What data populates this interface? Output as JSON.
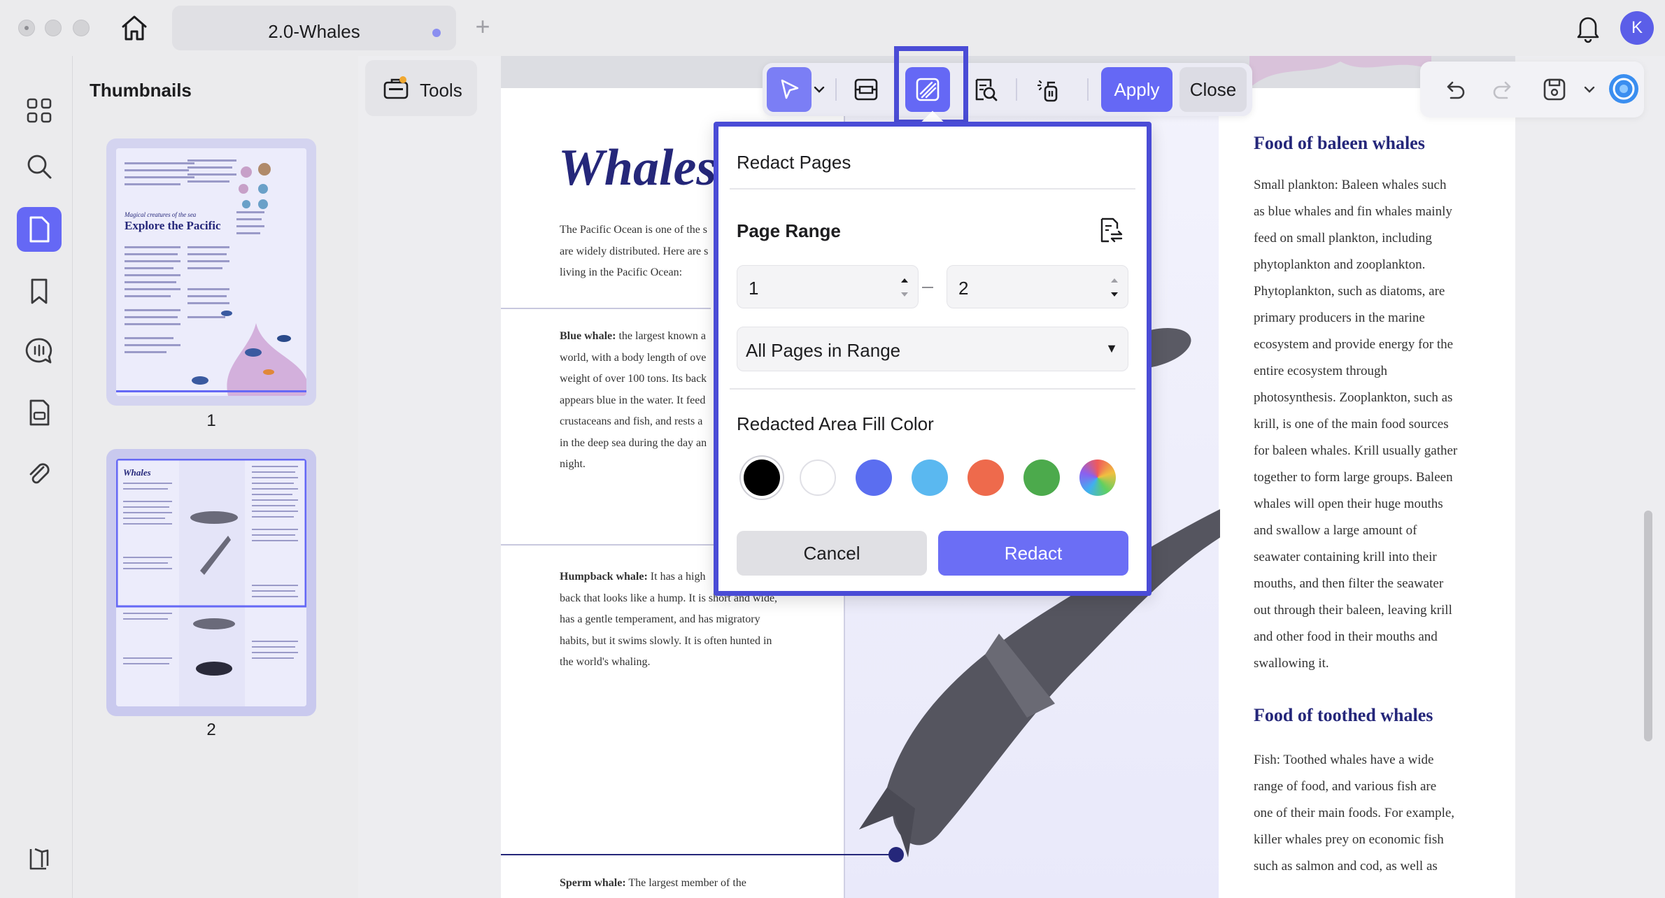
{
  "window": {
    "tab_title": "2.0-Whales",
    "avatar_initial": "K"
  },
  "sidebar": {
    "title": "Thumbnails",
    "pages": [
      "1",
      "2"
    ]
  },
  "tools": {
    "label": "Tools"
  },
  "toolbar": {
    "apply_label": "Apply",
    "close_label": "Close"
  },
  "redact_popover": {
    "title": "Redact Pages",
    "page_range_label": "Page Range",
    "range_from": "1",
    "range_to": "2",
    "subset_option": "All Pages in Range",
    "fill_color_label": "Redacted Area Fill Color",
    "colors": [
      "#000000",
      "#ffffff",
      "#5b6ef0",
      "#5ab8f0",
      "#ee6a4c",
      "#4caa4c",
      "multicolor"
    ],
    "selected_color": "#000000",
    "cancel_label": "Cancel",
    "redact_label": "Redact"
  },
  "document": {
    "title": "Whales",
    "intro_lines": [
      "The Pacific Ocean is one of the s",
      "are widely distributed. Here are s",
      "living in the Pacific Ocean:"
    ],
    "blue_whale": {
      "term": "Blue whale:",
      "lines": [
        " the largest known a",
        "world, with a body length of ove",
        "weight of over 100 tons. Its back",
        "appears blue in the water. It feed",
        "crustaceans and fish, and rests a",
        "in the deep sea during the day an",
        "night."
      ]
    },
    "humpback_whale": {
      "term": "Humpback whale:",
      "lines": [
        " It has a high",
        "back that looks like a hump. It is short and wide,",
        "has a gentle temperament, and has migratory",
        "habits, but it swims slowly. It is often hunted in",
        "the world's whaling."
      ]
    },
    "sperm_whale": {
      "term": "Sperm whale:",
      "lines": [
        " The largest member of the"
      ]
    },
    "baleen_heading": "Food of baleen whales",
    "baleen_lines": [
      "Small plankton: Baleen whales such",
      "as blue whales and fin whales mainly",
      "feed on small plankton, including",
      "phytoplankton and zooplankton.",
      "Phytoplankton, such as diatoms, are",
      "primary producers in the marine",
      "ecosystem and provide energy for the",
      "entire ecosystem through",
      "photosynthesis. Zooplankton, such as",
      "krill, is one of the main food sources",
      "for baleen whales. Krill usually gather",
      "together to form large groups. Baleen",
      "whales will open their huge mouths",
      "and swallow a large amount of",
      "seawater containing krill into their",
      "mouths, and then filter the seawater",
      "out through their baleen, leaving krill",
      "and other food in their mouths and",
      "swallowing it."
    ],
    "toothed_heading": "Food of toothed whales",
    "toothed_lines": [
      "Fish: Toothed whales have a wide",
      "range of food, and various fish are",
      "one of their main foods. For example,",
      "killer whales prey on economic fish",
      "such as salmon and cod, as well as"
    ]
  },
  "thumbnail_text": {
    "page1_subtitle": "Magical creatures of the sea",
    "page1_title": "Explore the Pacific",
    "page2_title": "Whales"
  }
}
